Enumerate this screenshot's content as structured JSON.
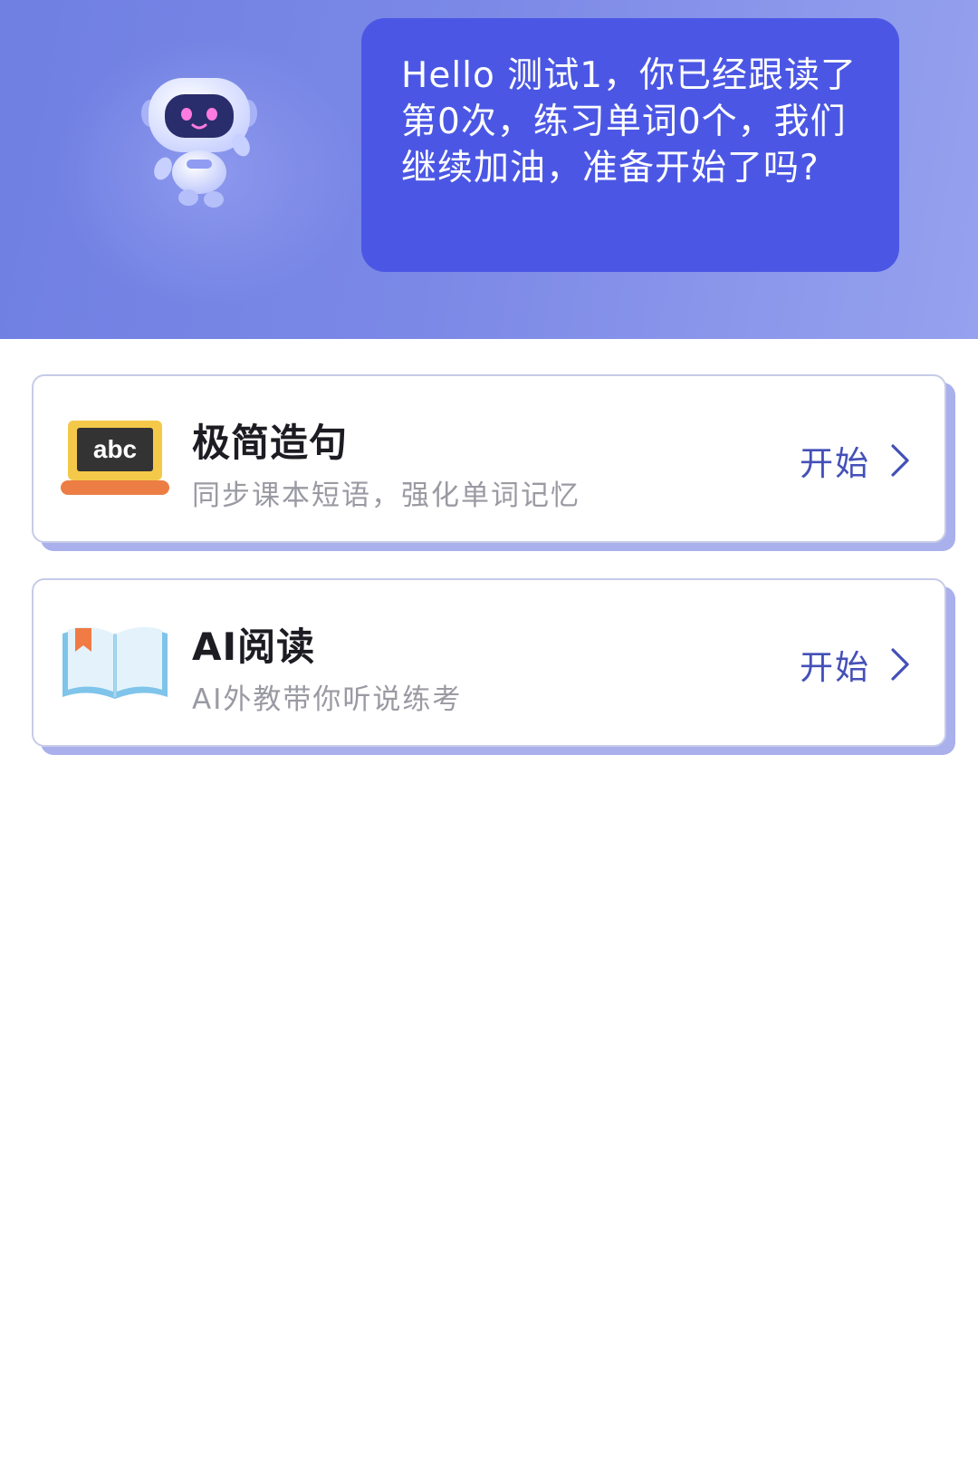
{
  "header": {
    "mascot": "robot-mascot",
    "greeting": "Hello 测试1，你已经跟读了第0次，练习单词0个，我们继续加油，准备开始了吗?"
  },
  "cards": [
    {
      "icon": "abc-blackboard-icon",
      "icon_text": "abc",
      "title": "极简造句",
      "subtitle": "同步课本短语，强化单词记忆",
      "action_label": "开始"
    },
    {
      "icon": "open-book-icon",
      "title": "AI阅读",
      "subtitle": "AI外教带你听说练考",
      "action_label": "开始"
    }
  ],
  "colors": {
    "header_gradient_start": "#6f7fe2",
    "header_gradient_end": "#96a2ee",
    "bubble": "#4b57e4",
    "accent": "#4450b8",
    "card_shadow": "#a9b0ec"
  }
}
